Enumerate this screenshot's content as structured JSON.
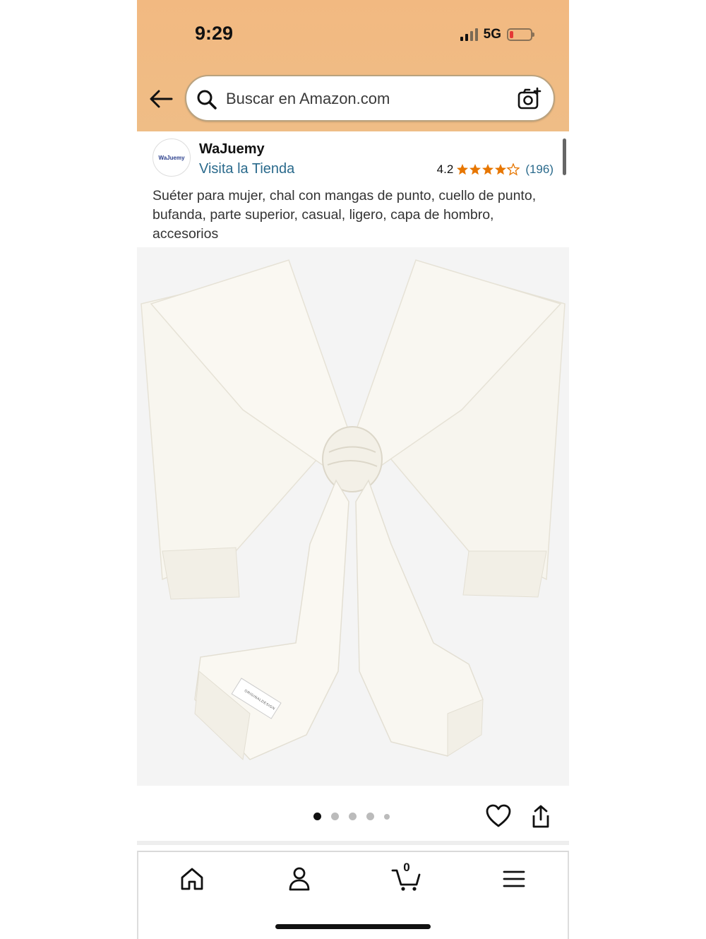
{
  "status_bar": {
    "time": "9:29",
    "network": "5G"
  },
  "search": {
    "placeholder": "Buscar en Amazon.com"
  },
  "store": {
    "logo_text": "WaJuemy",
    "name": "WaJuemy",
    "link_label": "Visita la Tienda",
    "rating": "4.2",
    "stars_value": 4.2,
    "reviews": "(196)"
  },
  "product": {
    "title": "Suéter para mujer, chal con mangas de punto, cuello de punto, bufanda, parte superior, casual, ligero, capa de hombro, accesorios",
    "image_label": "ORIGINALDESIGN",
    "image_count": 5,
    "active_image": 1
  },
  "icons": {
    "back": "back-arrow-icon",
    "search": "search-icon",
    "camera": "camera-search-icon",
    "heart": "heart-icon",
    "share": "share-icon",
    "home": "home-icon",
    "account": "user-icon",
    "cart": "cart-icon",
    "menu": "menu-icon"
  },
  "bottom_nav": {
    "cart_count": "0"
  },
  "colors": {
    "header": "#efbd86",
    "link": "#2a6a8c",
    "star": "#e77600"
  }
}
